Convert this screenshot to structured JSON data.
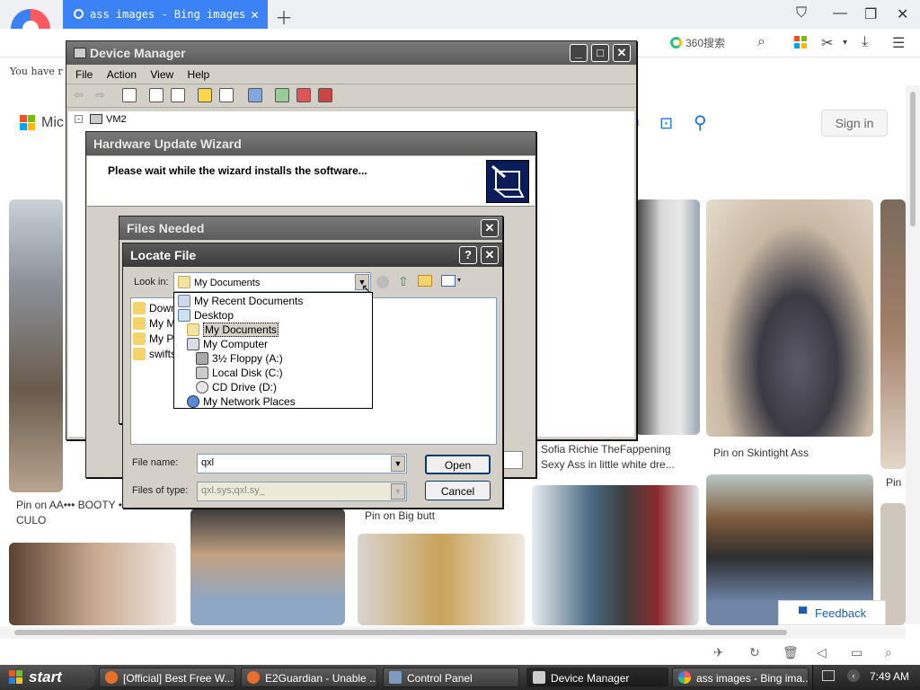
{
  "browser": {
    "tab_title": "ass images - Bing images",
    "search_provider": "360搜索",
    "infobar_text": "You have r"
  },
  "bing": {
    "logo_text": "Mic",
    "signin": "Sign in",
    "feedback": "Feedback",
    "captions": {
      "c1_line1": "Pin on AA••• BOOTY •",
      "c1_line2": "CULO",
      "c2": "Pin on Big butt",
      "c3_line1": "Sofia Richie TheFappening",
      "c3_line2": "Sexy Ass in little white dre...",
      "c4": "Pin on Skintight Ass",
      "c5": "Pin"
    }
  },
  "device_manager": {
    "title": "Device Manager",
    "menu": [
      "File",
      "Action",
      "View",
      "Help"
    ],
    "tree_root": "VM2"
  },
  "wizard": {
    "title": "Hardware Update Wizard",
    "heading": "Please wait while the wizard installs the software..."
  },
  "files_needed": {
    "title": "Files Needed"
  },
  "locate_file": {
    "title": "Locate File",
    "help_btn": "?",
    "look_in_label": "Look in:",
    "look_in_value": "My Documents",
    "dropdown_items": [
      "My Recent Documents",
      "Desktop",
      "My Documents",
      "My Computer",
      "3½ Floppy (A:)",
      "Local Disk (C:)",
      "CD Drive (D:)",
      "My Network Places"
    ],
    "folders": [
      "Downl",
      "My Mu",
      "My Pic",
      "swifts"
    ],
    "file_name_label": "File name:",
    "file_name_value": "qxl",
    "files_of_type_label": "Files of type:",
    "files_of_type_value": "qxl.sys;qxl.sy_",
    "open": "Open",
    "cancel": "Cancel"
  },
  "taskbar": {
    "start": "start",
    "tasks": [
      "[Official] Best Free W...",
      "E2Guardian - Unable ...",
      "Control Panel",
      "Device Manager",
      "ass images - Bing ima..."
    ],
    "clock": "7:49 AM"
  }
}
